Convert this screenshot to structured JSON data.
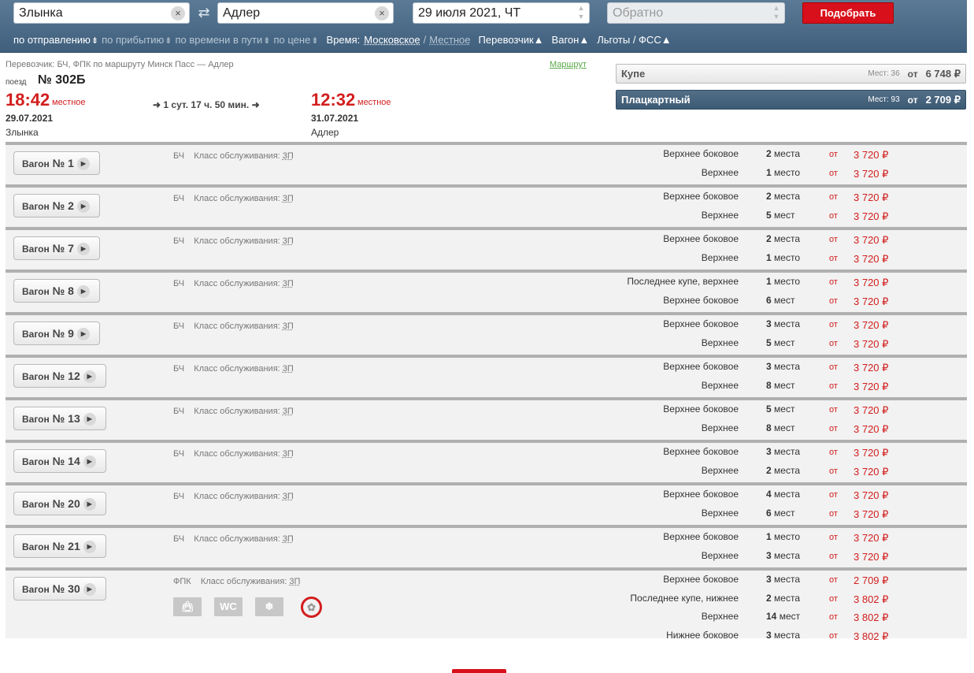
{
  "search": {
    "from": "Злынка",
    "to": "Адлер",
    "date": "29 июля 2021, ЧТ",
    "return_placeholder": "Обратно",
    "submit_label": "Подобрать"
  },
  "sort": {
    "by_departure": "по отправлению",
    "by_arrival": "по прибытию",
    "by_travel_time": "по времени в пути",
    "by_price": "по цене",
    "time_label": "Время:",
    "time_moscow": "Московское",
    "time_sep": "/",
    "time_local": "Местное",
    "carrier": "Перевозчик",
    "wagon": "Вагон",
    "benefits": "Льготы / ФСС"
  },
  "train": {
    "carrier_line": "Перевозчик: БЧ, ФПК    по маршруту Минск Пасс — Адлер",
    "route_link": "Маршрут",
    "train_label": "поезд",
    "number": "№ 302Б",
    "dep_time": "18:42",
    "dep_note": "местное",
    "dep_date": "29.07.2021",
    "dep_station": "Злынка",
    "duration": "1 сут. 17 ч. 50 мин.",
    "arr_time": "12:32",
    "arr_note": "местное",
    "arr_date": "31.07.2021",
    "arr_station": "Адлер"
  },
  "classes": [
    {
      "name": "Купе",
      "seats": "Мест: 36",
      "from": "от",
      "price": "6 748 ₽"
    },
    {
      "name": "Плацкартный",
      "seats": "Мест: 93",
      "from": "от",
      "price": "2 709 ₽"
    }
  ],
  "wagons": [
    {
      "label": "Вагон",
      "num": "№ 1",
      "carrier": "БЧ",
      "class_label": "Класс обслуживания:",
      "class": "3П",
      "seats": [
        {
          "type": "Верхнее боковое",
          "n": "2",
          "unit": "места",
          "from": "от",
          "price": "3 720 ₽"
        },
        {
          "type": "Верхнее",
          "n": "1",
          "unit": "место",
          "from": "от",
          "price": "3 720 ₽"
        }
      ]
    },
    {
      "label": "Вагон",
      "num": "№ 2",
      "carrier": "БЧ",
      "class_label": "Класс обслуживания:",
      "class": "3П",
      "seats": [
        {
          "type": "Верхнее боковое",
          "n": "2",
          "unit": "места",
          "from": "от",
          "price": "3 720 ₽"
        },
        {
          "type": "Верхнее",
          "n": "5",
          "unit": "мест",
          "from": "от",
          "price": "3 720 ₽"
        }
      ]
    },
    {
      "label": "Вагон",
      "num": "№ 7",
      "carrier": "БЧ",
      "class_label": "Класс обслуживания:",
      "class": "3П",
      "seats": [
        {
          "type": "Верхнее боковое",
          "n": "2",
          "unit": "места",
          "from": "от",
          "price": "3 720 ₽"
        },
        {
          "type": "Верхнее",
          "n": "1",
          "unit": "место",
          "from": "от",
          "price": "3 720 ₽"
        }
      ]
    },
    {
      "label": "Вагон",
      "num": "№ 8",
      "carrier": "БЧ",
      "class_label": "Класс обслуживания:",
      "class": "3П",
      "seats": [
        {
          "type": "Последнее купе, верхнее",
          "n": "1",
          "unit": "место",
          "from": "от",
          "price": "3 720 ₽"
        },
        {
          "type": "Верхнее боковое",
          "n": "6",
          "unit": "мест",
          "from": "от",
          "price": "3 720 ₽"
        }
      ]
    },
    {
      "label": "Вагон",
      "num": "№ 9",
      "carrier": "БЧ",
      "class_label": "Класс обслуживания:",
      "class": "3П",
      "seats": [
        {
          "type": "Верхнее боковое",
          "n": "3",
          "unit": "места",
          "from": "от",
          "price": "3 720 ₽"
        },
        {
          "type": "Верхнее",
          "n": "5",
          "unit": "мест",
          "from": "от",
          "price": "3 720 ₽"
        }
      ]
    },
    {
      "label": "Вагон",
      "num": "№ 12",
      "carrier": "БЧ",
      "class_label": "Класс обслуживания:",
      "class": "3П",
      "seats": [
        {
          "type": "Верхнее боковое",
          "n": "3",
          "unit": "места",
          "from": "от",
          "price": "3 720 ₽"
        },
        {
          "type": "Верхнее",
          "n": "8",
          "unit": "мест",
          "from": "от",
          "price": "3 720 ₽"
        }
      ]
    },
    {
      "label": "Вагон",
      "num": "№ 13",
      "carrier": "БЧ",
      "class_label": "Класс обслуживания:",
      "class": "3П",
      "seats": [
        {
          "type": "Верхнее боковое",
          "n": "5",
          "unit": "мест",
          "from": "от",
          "price": "3 720 ₽"
        },
        {
          "type": "Верхнее",
          "n": "8",
          "unit": "мест",
          "from": "от",
          "price": "3 720 ₽"
        }
      ]
    },
    {
      "label": "Вагон",
      "num": "№ 14",
      "carrier": "БЧ",
      "class_label": "Класс обслуживания:",
      "class": "3П",
      "seats": [
        {
          "type": "Верхнее боковое",
          "n": "3",
          "unit": "места",
          "from": "от",
          "price": "3 720 ₽"
        },
        {
          "type": "Верхнее",
          "n": "2",
          "unit": "места",
          "from": "от",
          "price": "3 720 ₽"
        }
      ]
    },
    {
      "label": "Вагон",
      "num": "№ 20",
      "carrier": "БЧ",
      "class_label": "Класс обслуживания:",
      "class": "3П",
      "seats": [
        {
          "type": "Верхнее боковое",
          "n": "4",
          "unit": "места",
          "from": "от",
          "price": "3 720 ₽"
        },
        {
          "type": "Верхнее",
          "n": "6",
          "unit": "мест",
          "from": "от",
          "price": "3 720 ₽"
        }
      ]
    },
    {
      "label": "Вагон",
      "num": "№ 21",
      "carrier": "БЧ",
      "class_label": "Класс обслуживания:",
      "class": "3П",
      "seats": [
        {
          "type": "Верхнее боковое",
          "n": "1",
          "unit": "место",
          "from": "от",
          "price": "3 720 ₽"
        },
        {
          "type": "Верхнее",
          "n": "3",
          "unit": "места",
          "from": "от",
          "price": "3 720 ₽"
        }
      ]
    },
    {
      "label": "Вагон",
      "num": "№ 30",
      "carrier": "ФПК",
      "class_label": "Класс обслуживания:",
      "class": "3П",
      "amenities": [
        "bag-icon",
        "wc-icon",
        "snowflake-icon",
        "no-pets-icon"
      ],
      "amenity_text": {
        "wc": "WC"
      },
      "seats": [
        {
          "type": "Верхнее боковое",
          "n": "3",
          "unit": "места",
          "from": "от",
          "price": "2 709 ₽"
        },
        {
          "type": "Последнее купе, нижнее",
          "n": "2",
          "unit": "места",
          "from": "от",
          "price": "3 802 ₽"
        },
        {
          "type": "Верхнее",
          "n": "14",
          "unit": "мест",
          "from": "от",
          "price": "3 802 ₽"
        },
        {
          "type": "Нижнее боковое",
          "n": "3",
          "unit": "места",
          "from": "от",
          "price": "3 802 ₽"
        }
      ]
    }
  ]
}
